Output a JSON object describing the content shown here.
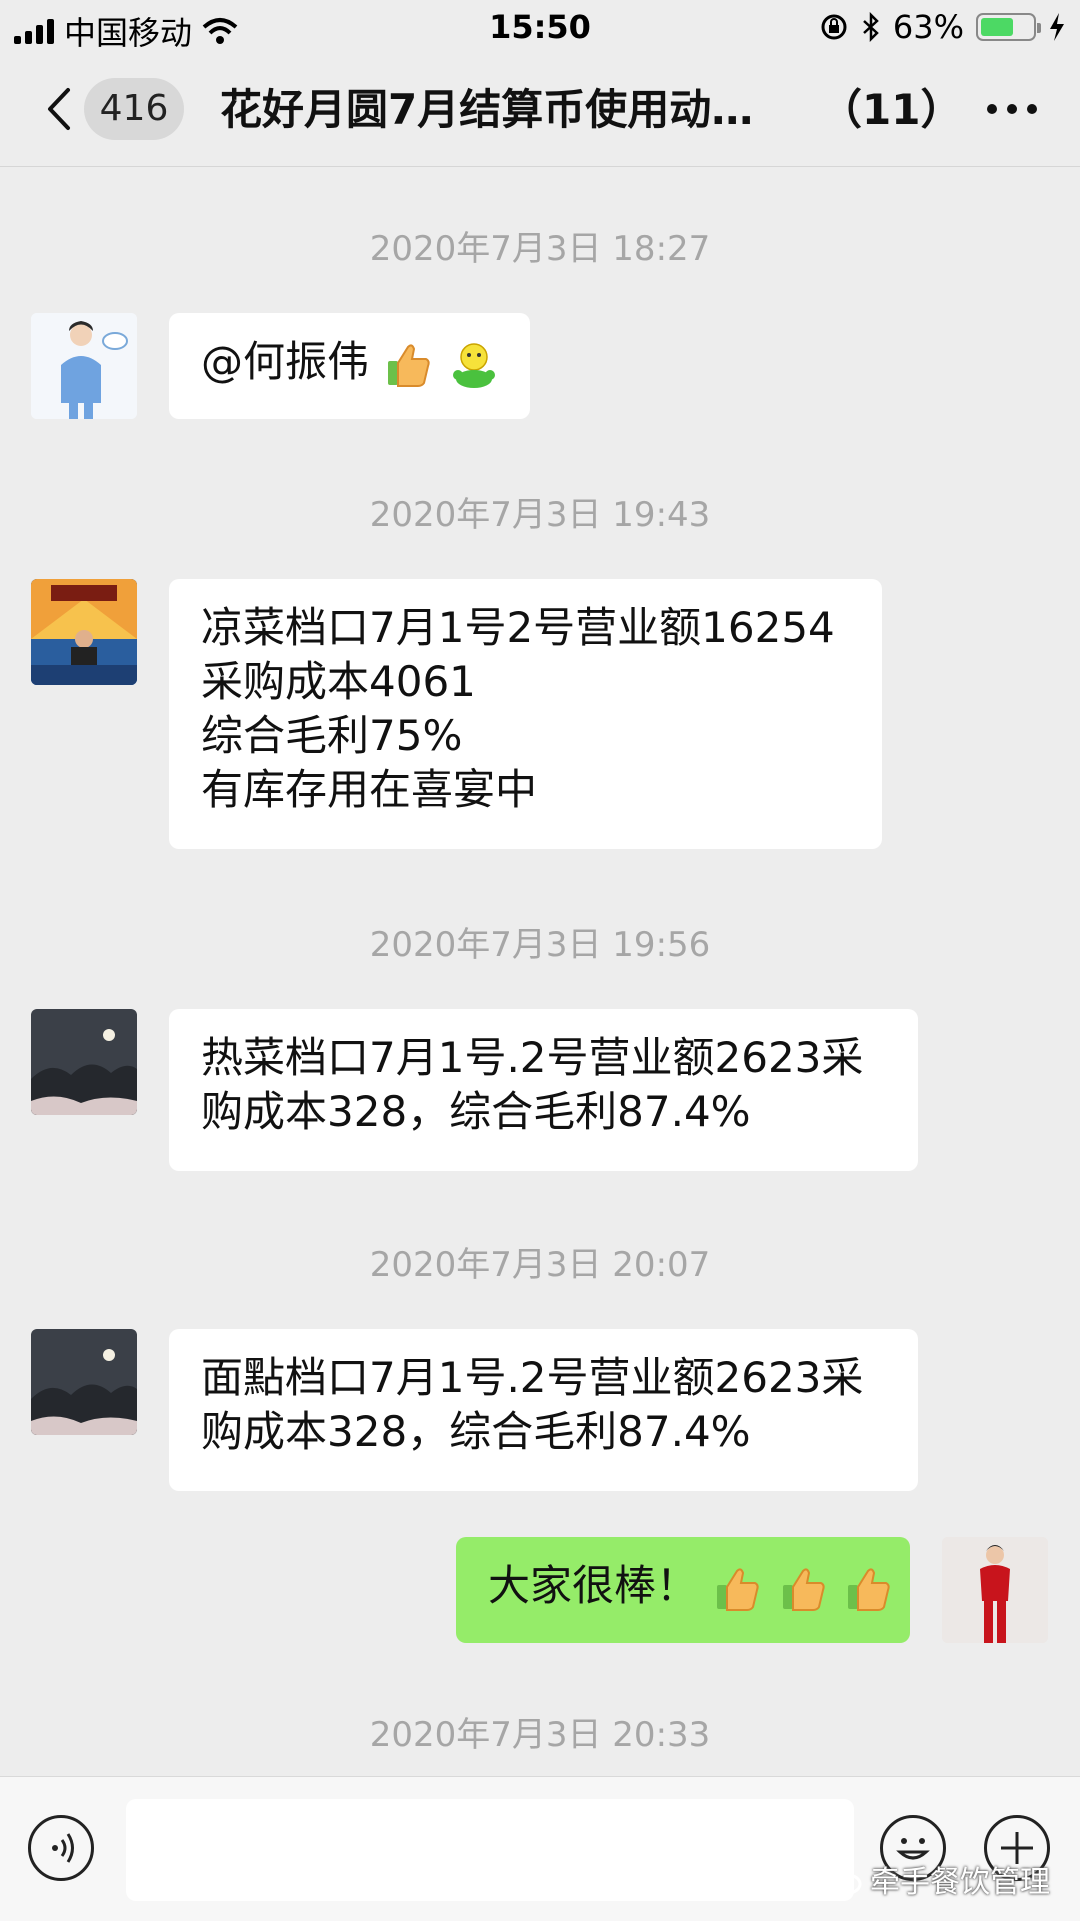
{
  "status_bar": {
    "carrier": "中国移动",
    "time": "15:50",
    "battery_percent": "63%",
    "battery_level": 0.63
  },
  "nav": {
    "unread_badge": "416",
    "title": "花好月圆7月结算币使用动…",
    "member_count": "（11）"
  },
  "messages": [
    {
      "timestamp": "2020年7月3日 18:27",
      "sender": "other",
      "lines": [
        "@何振伟"
      ],
      "emojis": [
        "thumbs-up-emoji",
        "green-smiley-emoji"
      ]
    },
    {
      "timestamp": "2020年7月3日 19:43",
      "sender": "other",
      "lines": [
        "凉菜档口7月1号2号营业额16254",
        "采购成本4061",
        "综合毛利75%",
        "有库存用在喜宴中"
      ]
    },
    {
      "timestamp": "2020年7月3日 19:56",
      "sender": "other",
      "lines": [
        "热菜档口7月1号.2号营业额2623采",
        "购成本328，综合毛利87.4%"
      ]
    },
    {
      "timestamp": "2020年7月3日 20:07",
      "sender": "other",
      "lines": [
        "面點档口7月1号.2号营业额2623采",
        "购成本328，综合毛利87.4%"
      ]
    },
    {
      "sender": "me",
      "lines": [
        "大家很棒！"
      ],
      "emojis": [
        "thumbs-up-emoji",
        "thumbs-up-emoji",
        "thumbs-up-emoji"
      ]
    },
    {
      "timestamp": "2020年7月3日 20:33"
    }
  ],
  "input": {
    "placeholder": ""
  },
  "watermark": "牵手餐饮管理",
  "colors": {
    "background": "#ededed",
    "my_bubble": "#95ec69",
    "other_bubble": "#ffffff",
    "timestamp_text": "#a6a6a6",
    "battery_fill": "#4cd964"
  }
}
